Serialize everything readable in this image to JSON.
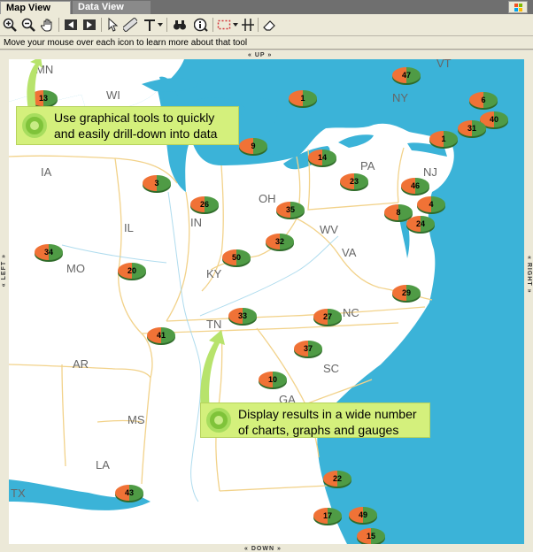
{
  "tabs": [
    {
      "label": "Map View",
      "active": true
    },
    {
      "label": "Data View",
      "active": false
    }
  ],
  "toolbar": {
    "icons": [
      "zoom-in-icon",
      "zoom-out-icon",
      "pan-hand-icon",
      "back-icon",
      "forward-icon",
      "select-arrow-icon",
      "ruler-icon",
      "text-icon",
      "binoculars-icon",
      "info-icon",
      "selection-box-icon",
      "split-icon",
      "eraser-icon"
    ]
  },
  "status": {
    "text": "Move your mouse over each icon to learn more about that tool"
  },
  "pan": {
    "up": "UP",
    "down": "DOWN",
    "left": "LEFT",
    "right": "RIGHT"
  },
  "colors": {
    "water": "#3bb3d8",
    "land": "#ffffff",
    "border": "#f2d28a",
    "pie_green": "#4f9b45",
    "pie_orange": "#f07236",
    "callout": "#d4f07c"
  },
  "state_labels": [
    "MN",
    "WI",
    "IA",
    "IL",
    "IN",
    "OH",
    "PA",
    "NY",
    "NJ",
    "WV",
    "VA",
    "KY",
    "MO",
    "TN",
    "NC",
    "SC",
    "GA",
    "AR",
    "MS",
    "LA",
    "TX",
    "VT"
  ],
  "markers": [
    "13",
    "1",
    "47",
    "6",
    "40",
    "31",
    "1",
    "9",
    "14",
    "23",
    "46",
    "3",
    "26",
    "35",
    "4",
    "8",
    "24",
    "34",
    "32",
    "20",
    "50",
    "29",
    "33",
    "27",
    "41",
    "37",
    "10",
    "43",
    "22",
    "17",
    "49",
    "15"
  ],
  "callouts": [
    {
      "text": "Use graphical tools to quickly and easily drill-down into data"
    },
    {
      "text": "Display results in a wide number of charts, graphs and gauges"
    }
  ]
}
